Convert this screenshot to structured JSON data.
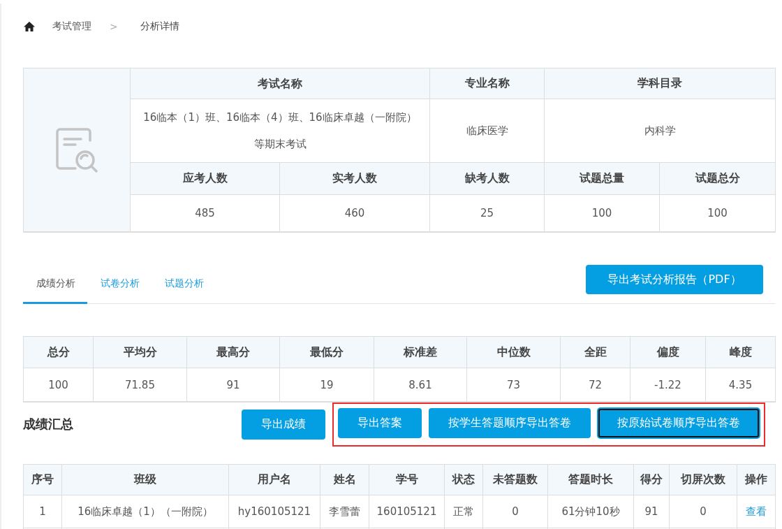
{
  "breadcrumb": {
    "items": [
      "考试管理",
      "分析详情"
    ],
    "separator": ">"
  },
  "exam_info": {
    "header_row": [
      "考试名称",
      "专业名称",
      "学科目录"
    ],
    "value_row": [
      "16临本（1）班、16临本（4）班、16临床卓越（一附院）等期末考试",
      "临床医学",
      "内科学"
    ],
    "count_header_row": [
      "应考人数",
      "实考人数",
      "缺考人数",
      "试题总量",
      "试题总分"
    ],
    "count_value_row": [
      "485",
      "460",
      "25",
      "100",
      "100"
    ]
  },
  "tabs": [
    {
      "label": "成绩分析",
      "selected": true
    },
    {
      "label": "试卷分析",
      "selected": false
    },
    {
      "label": "试题分析",
      "selected": false
    }
  ],
  "export_report_button": "导出考试分析报告（PDF）",
  "stats_table": {
    "columns": [
      "总分",
      "平均分",
      "最高分",
      "最低分",
      "标准差",
      "中位数",
      "全距",
      "偏度",
      "峰度"
    ],
    "values": [
      "100",
      "71.85",
      "91",
      "19",
      "8.61",
      "73",
      "72",
      "-1.22",
      "4.35"
    ]
  },
  "summary": {
    "title": "成绩汇总",
    "buttons": [
      {
        "label": "导出成绩",
        "highlighted": false,
        "focused": false
      },
      {
        "label": "导出答案",
        "highlighted": true,
        "focused": false
      },
      {
        "label": "按学生答题顺序导出答卷",
        "highlighted": true,
        "focused": false
      },
      {
        "label": "按原始试卷顺序导出答卷",
        "highlighted": true,
        "focused": true
      }
    ]
  },
  "results_table": {
    "columns": [
      "序号",
      "班级",
      "用户名",
      "姓名",
      "学号",
      "状态",
      "未答题数",
      "答题时长",
      "得分",
      "切屏次数",
      "操作"
    ],
    "rows": [
      {
        "cells": [
          "1",
          "16临床卓越（1）（一附院）",
          "hy160105121",
          "李雪蕾",
          "160105121",
          "正常",
          "0",
          "61分钟10秒",
          "91",
          "0"
        ],
        "action": "查看"
      }
    ]
  }
}
